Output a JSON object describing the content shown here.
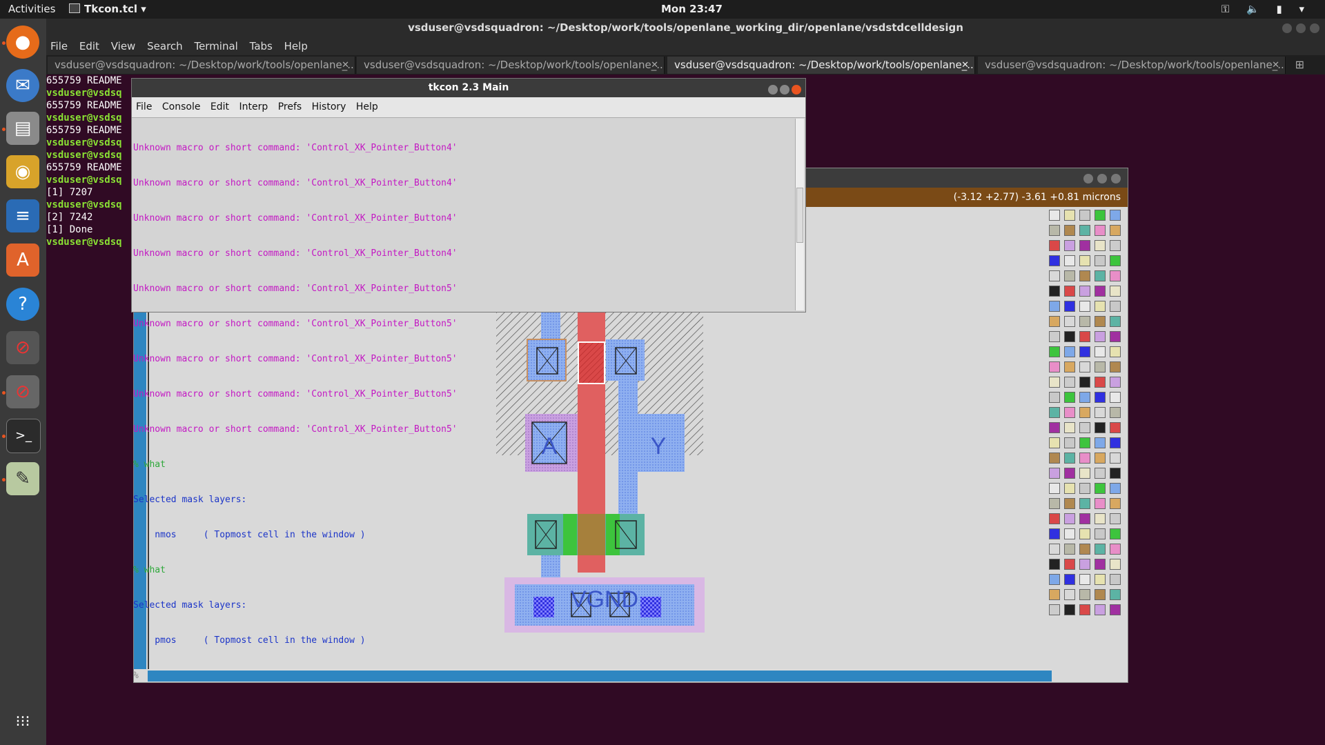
{
  "topbar": {
    "activities": "Activities",
    "app_name": "Tkcon.tcl",
    "clock": "Mon 23:47"
  },
  "dock": {
    "items": [
      "firefox-icon",
      "thunderbird-icon",
      "files-icon",
      "rhythmbox-icon",
      "writer-icon",
      "software-icon",
      "help-icon",
      "blocked-icon",
      "blocked-icon",
      "terminal-icon",
      "image-viewer-icon"
    ],
    "apps_grid": "show-applications-icon"
  },
  "terminal": {
    "title": "vsduser@vsdsquadron: ~/Desktop/work/tools/openlane_working_dir/openlane/vsdstdcelldesign",
    "menu": [
      "File",
      "Edit",
      "View",
      "Search",
      "Terminal",
      "Tabs",
      "Help"
    ],
    "tabs": [
      "vsduser@vsdsquadron: ~/Desktop/work/tools/openlane_...",
      "vsduser@vsdsquadron: ~/Desktop/work/tools/openlane_...",
      "vsduser@vsdsquadron: ~/Desktop/work/tools/openlane_...",
      "vsduser@vsdsquadron: ~/Desktop/work/tools/openlane_..."
    ],
    "lines": [
      "655759 README",
      "vsduser@vsdsq",
      "655759 README",
      "vsduser@vsdsq",
      "655759 README",
      "vsduser@vsdsq",
      "vsduser@vsdsq",
      "655759 README",
      "vsduser@vsdsq",
      "[1] 7207",
      "vsduser@vsdsq",
      "[2] 7242",
      "[1]   Done",
      "vsduser@vsdsq"
    ]
  },
  "tkcon": {
    "title": "tkcon 2.3 Main",
    "menu": [
      "File",
      "Console",
      "Edit",
      "Interp",
      "Prefs",
      "History",
      "Help"
    ],
    "errors": [
      "Unknown macro or short command: 'Control_XK_Pointer_Button4'",
      "Unknown macro or short command: 'Control_XK_Pointer_Button4'",
      "Unknown macro or short command: 'Control_XK_Pointer_Button4'",
      "Unknown macro or short command: 'Control_XK_Pointer_Button4'",
      "Unknown macro or short command: 'Control_XK_Pointer_Button5'",
      "Unknown macro or short command: 'Control_XK_Pointer_Button5'",
      "Unknown macro or short command: 'Control_XK_Pointer_Button5'",
      "Unknown macro or short command: 'Control_XK_Pointer_Button5'",
      "Unknown macro or short command: 'Control_XK_Pointer_Button5'"
    ],
    "cmd1": "% what",
    "out1a": "Selected mask layers:",
    "out1b": "    nmos     ( Topmost cell in the window )",
    "cmd2": "% what",
    "out2a": "Selected mask layers:",
    "out2b": "    pmos     ( Topmost cell in the window )",
    "prompt": "%"
  },
  "magic": {
    "coords": "(-3.12 +2.77) -3.61 +0.81 microns",
    "labels": {
      "a": "A",
      "y": "Y",
      "vgnd": "VGND"
    }
  }
}
